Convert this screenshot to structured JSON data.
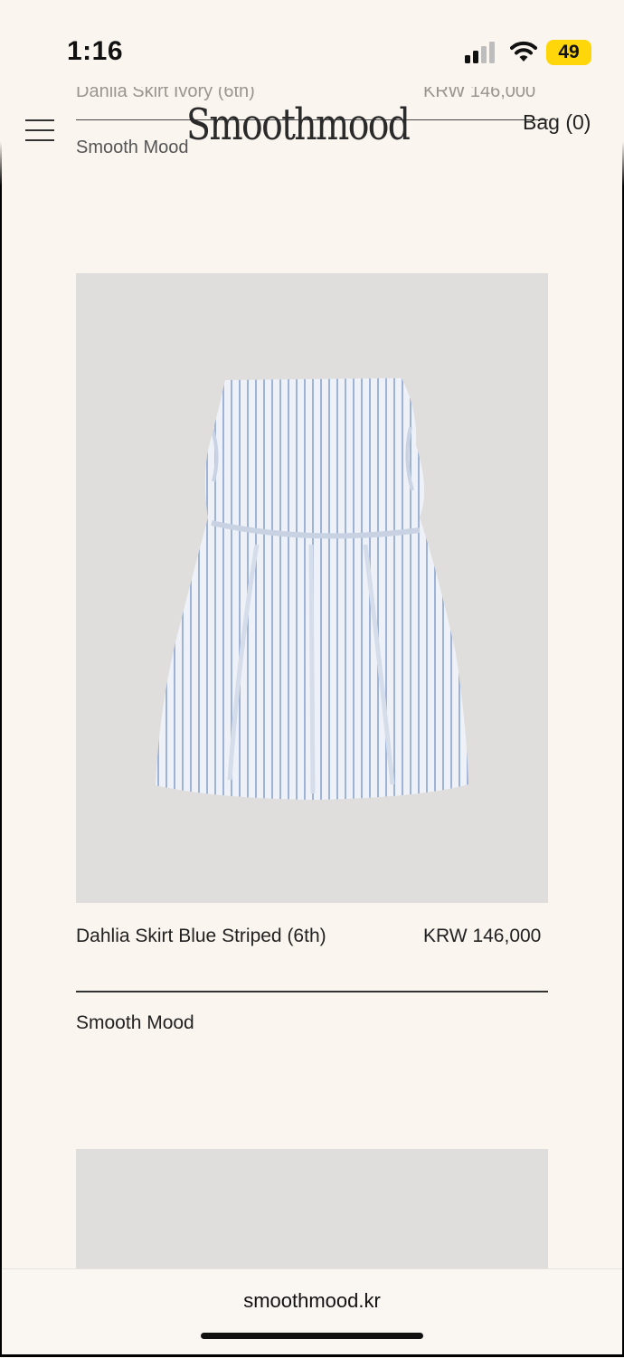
{
  "status_bar": {
    "time": "1:16",
    "battery": "49",
    "battery_color": "#ffd60a"
  },
  "previous_product": {
    "name": "Dahlia Skirt Ivory (6th)",
    "price": "KRW 146,000",
    "brand": "Smooth Mood"
  },
  "header": {
    "logo": "Smoothmood",
    "bag_label": "Bag (0)",
    "menu_icon": "hamburger-menu-icon"
  },
  "product": {
    "name": "Dahlia Skirt Blue Striped (6th)",
    "price": "KRW 146,000",
    "brand": "Smooth Mood",
    "image_bg": "#dfdedc",
    "stripe_color": "#9fb3d6"
  },
  "address_bar": {
    "url": "smoothmood.kr"
  },
  "colors": {
    "page_bg": "#fbf5ef",
    "text": "#222222",
    "muted": "#9a9590"
  }
}
